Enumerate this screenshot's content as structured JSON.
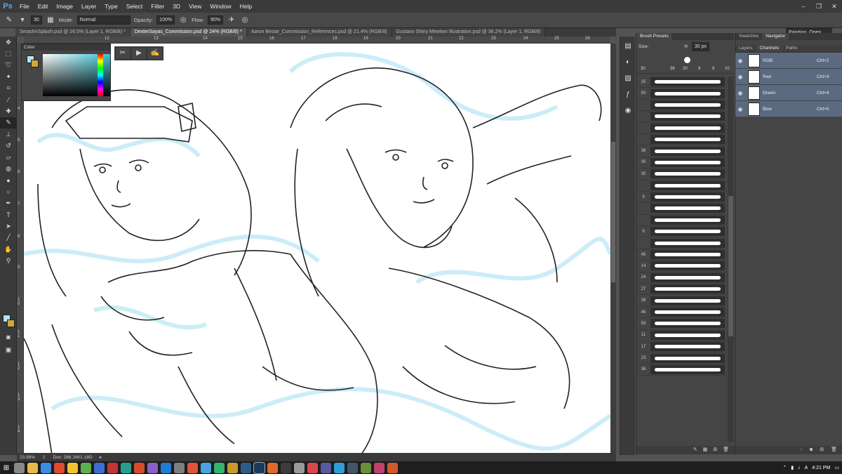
{
  "app": {
    "logo": "Ps"
  },
  "menu": [
    "File",
    "Edit",
    "Image",
    "Layer",
    "Type",
    "Select",
    "Filter",
    "3D",
    "View",
    "Window",
    "Help"
  ],
  "window_controls": [
    "–",
    "❐",
    "✕"
  ],
  "options": {
    "brush_size": "30",
    "mode_label": "Mode:",
    "mode_value": "Normal",
    "opacity_label": "Opacity:",
    "opacity_value": "100%",
    "flow_label": "Flow:",
    "flow_value": "90%",
    "workspace": "Painting_Open"
  },
  "tabs": [
    {
      "label": "SmashnSplash.psd @ 26.5% (Layer 1, RGB/8) *"
    },
    {
      "label": "DexterSayas_Commission.psd @ 24% (RGB/8) *"
    },
    {
      "label": "Aaron Besse_Commission_References.psd @ 21.4% (RGB/8)"
    },
    {
      "label": "Gustavo Shiny Mewtwo Illustration.psd @ 36.2% (Layer 1, RGB/8)"
    }
  ],
  "ruler_top": [
    "12",
    "13",
    "14",
    "15",
    "16",
    "17",
    "18",
    "19",
    "20",
    "21",
    "22",
    "23",
    "24",
    "25",
    "26"
  ],
  "ruler_left": [
    "4",
    "5",
    "6",
    "7",
    "8",
    "9",
    "1 0",
    "1 1",
    "1 2",
    "1 3",
    "1 4"
  ],
  "color_panel": {
    "title": "Color"
  },
  "status": {
    "zoom": "23.98%",
    "doc": "Doc: 286.1M/1.18G"
  },
  "brush_presets": {
    "tabs": [
      "Brush Presets"
    ],
    "size_label": "Size:",
    "size_value": "30 px",
    "preset_sizes": [
      "30",
      "36",
      "20",
      "8",
      "9",
      "10"
    ],
    "list_sizes": [
      "25",
      "50",
      "",
      "",
      "",
      "",
      "36",
      "30",
      "30",
      "",
      "9",
      "",
      "",
      "9",
      "",
      "45",
      "14",
      "24",
      "27",
      "39",
      "46",
      "59",
      "11",
      "17",
      "23",
      "36"
    ]
  },
  "right_panel": {
    "top_tabs": [
      "Swatches",
      "Navigator"
    ],
    "layer_tabs": [
      "Layers",
      "Channels",
      "Paths"
    ],
    "channels": [
      {
        "name": "RGB",
        "shortcut": "Ctrl+2"
      },
      {
        "name": "Red",
        "shortcut": "Ctrl+3"
      },
      {
        "name": "Green",
        "shortcut": "Ctrl+4"
      },
      {
        "name": "Blue",
        "shortcut": "Ctrl+5"
      }
    ]
  },
  "taskbar": {
    "time": "4:21 PM",
    "lang": "A"
  },
  "colors": {
    "foreground": "#aee6f5",
    "background": "#d4a63a",
    "accent": "#5aa8f0"
  }
}
